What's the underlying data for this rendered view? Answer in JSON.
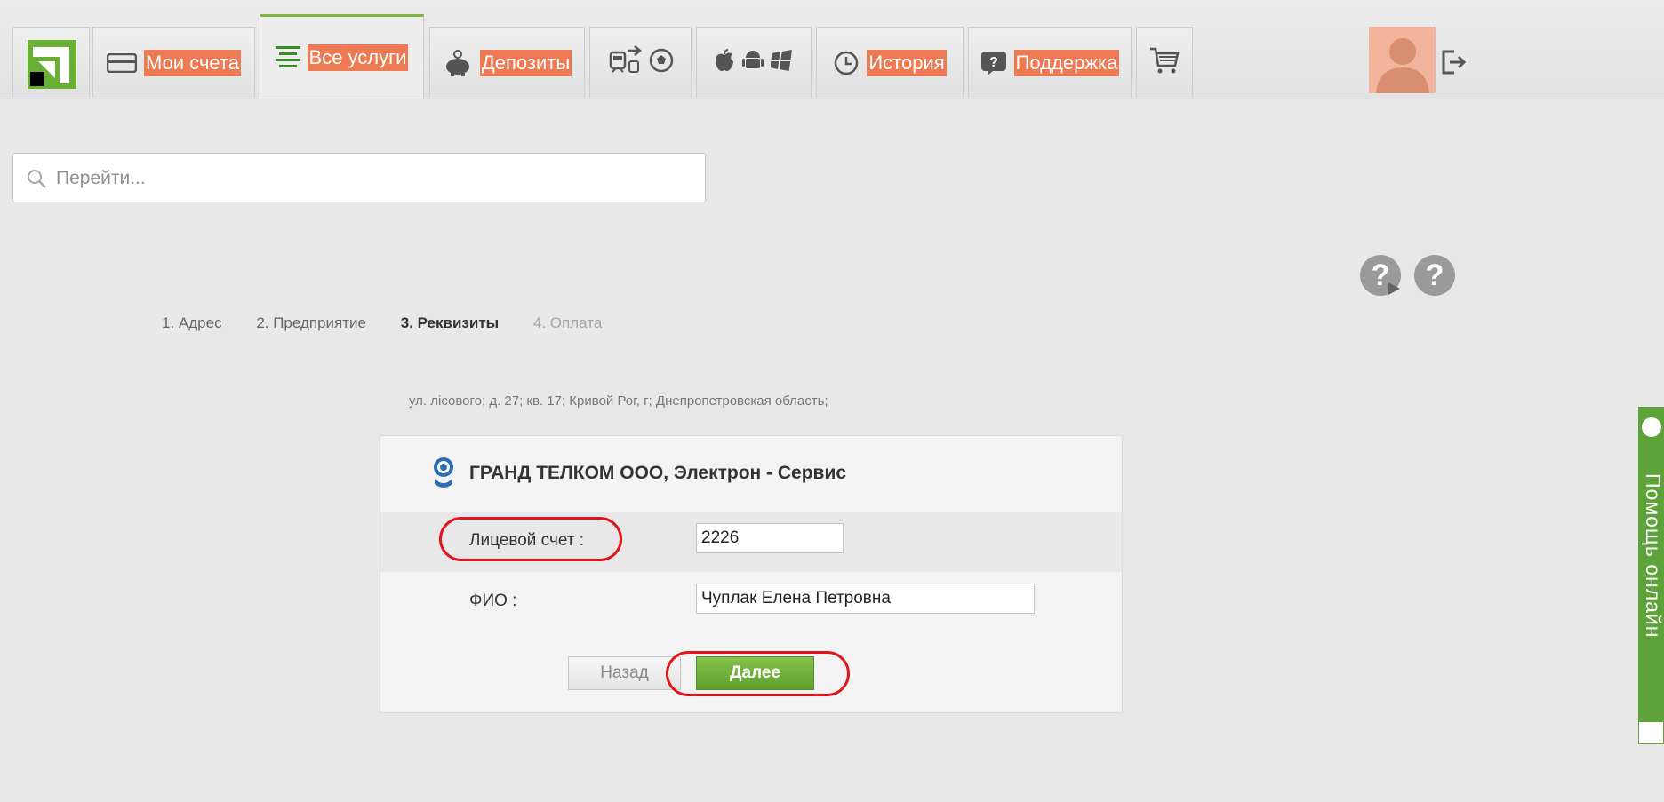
{
  "nav": {
    "my_accounts": "Мои счета",
    "all_services": "Все услуги",
    "deposits": "Депозиты",
    "history": "История",
    "support": "Поддержка"
  },
  "search": {
    "placeholder": "Перейти..."
  },
  "help": {
    "video_label": "?",
    "info_label": "?"
  },
  "steps": {
    "step1": "1.  Адрес",
    "step2": "2.  Предприятие",
    "step3": "3.  Реквизиты",
    "step4": "4.  Оплата"
  },
  "address": "ул. лісового; д. 27; кв. 17; Кривой Рог, г; Днепропетровская область;",
  "form": {
    "title": "ГРАНД ТЕЛКОМ ООО, Электрон - Сервис",
    "account_label": "Лицевой счет :",
    "account_value": "2226",
    "name_label": "ФИО :",
    "name_value": "Чуплак Елена Петровна",
    "back_label": "Назад",
    "next_label": "Далее"
  },
  "side_help": {
    "label": "Помощь онлайн"
  },
  "colors": {
    "accent_green": "#6ab035",
    "nav_label_bg": "#ed7a52",
    "highlight_red": "#e0141a"
  }
}
